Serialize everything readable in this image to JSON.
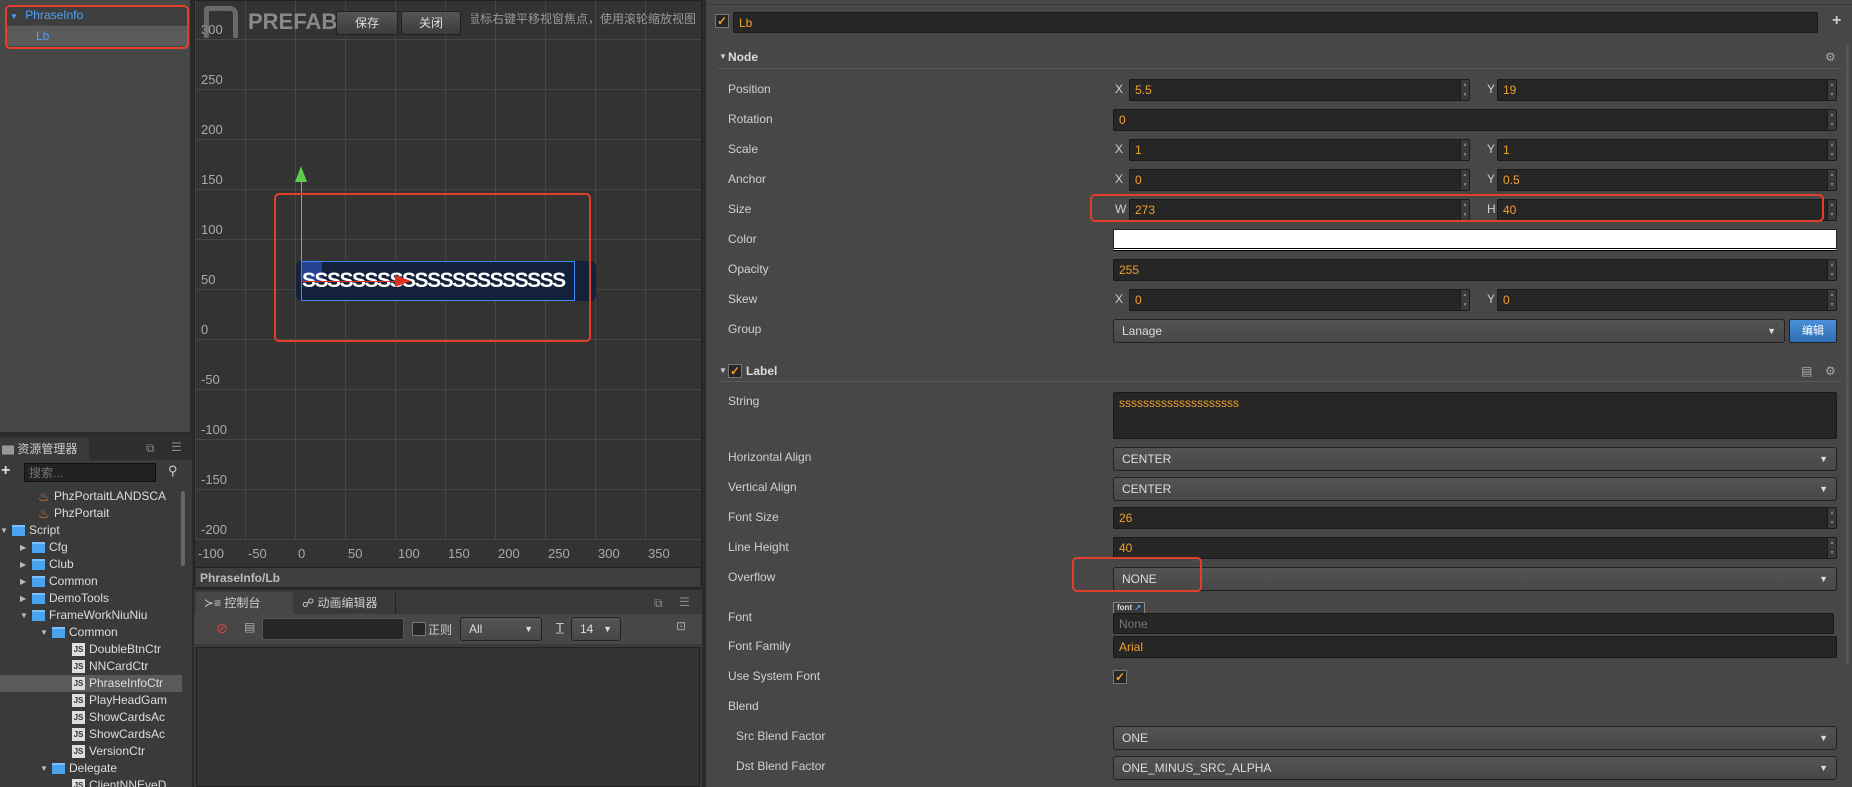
{
  "hierarchy": {
    "items": [
      {
        "label": "PhraseInfo",
        "expanded": true
      },
      {
        "label": "Lb",
        "selected": true
      }
    ]
  },
  "scene": {
    "logo": "PREFAB",
    "save_label": "保存",
    "close_label": "关闭",
    "hint": "按下鼠标右键平移视窗焦点，使用滚轮缩放视图",
    "y_ticks": [
      "300",
      "250",
      "200",
      "150",
      "100",
      "50",
      "0",
      "-50",
      "-100",
      "-150",
      "-200"
    ],
    "x_ticks": [
      "-100",
      "-50",
      "0",
      "50",
      "100",
      "150",
      "200",
      "250",
      "300",
      "350"
    ],
    "node_text": "SSSSSSSSSSSSSSSSSSSSS",
    "path": "PhraseInfo/Lb"
  },
  "assets": {
    "tab": "资源管理器",
    "search_placeholder": "搜索...",
    "items": [
      {
        "label": "PhzPortaitLANDSCA",
        "icon": "fire",
        "depth": 2
      },
      {
        "label": "PhzPortait",
        "icon": "fire",
        "depth": 2
      },
      {
        "label": "Script",
        "icon": "folder",
        "depth": 1,
        "arrow": "down"
      },
      {
        "label": "Cfg",
        "icon": "folder",
        "depth": 2,
        "arrow": "right"
      },
      {
        "label": "Club",
        "icon": "folder",
        "depth": 2,
        "arrow": "right"
      },
      {
        "label": "Common",
        "icon": "folder",
        "depth": 2,
        "arrow": "right"
      },
      {
        "label": "DemoTools",
        "icon": "folder",
        "depth": 2,
        "arrow": "right"
      },
      {
        "label": "FrameWorkNiuNiu",
        "icon": "folder",
        "depth": 2,
        "arrow": "down"
      },
      {
        "label": "Common",
        "icon": "folder",
        "depth": 3,
        "arrow": "down"
      },
      {
        "label": "DoubleBtnCtr",
        "icon": "js",
        "depth": 4
      },
      {
        "label": "NNCardCtr",
        "icon": "js",
        "depth": 4
      },
      {
        "label": "PhraseInfoCtr",
        "icon": "js",
        "depth": 4,
        "selected": true
      },
      {
        "label": "PlayHeadGam",
        "icon": "js",
        "depth": 4
      },
      {
        "label": "ShowCardsAc",
        "icon": "js",
        "depth": 4
      },
      {
        "label": "ShowCardsAc",
        "icon": "js",
        "depth": 4
      },
      {
        "label": "VersionCtr",
        "icon": "js",
        "depth": 4
      },
      {
        "label": "Delegate",
        "icon": "folder",
        "depth": 3,
        "arrow": "down"
      },
      {
        "label": "ClientNNEveD",
        "icon": "js",
        "depth": 4
      }
    ]
  },
  "console": {
    "tab_console": "控制台",
    "tab_anim": "动画编辑器",
    "regex_label": "正则",
    "level": "All",
    "font_size": "14"
  },
  "inspector": {
    "node_name": "Lb",
    "node_header": "Node",
    "label_header": "Label",
    "accent": "#f0a030",
    "rows": [
      {
        "label": "Position",
        "type": "vec2",
        "a": "X",
        "av": "5.5",
        "b": "Y",
        "bv": "19"
      },
      {
        "label": "Rotation",
        "type": "num",
        "v": "0"
      },
      {
        "label": "Scale",
        "type": "vec2",
        "a": "X",
        "av": "1",
        "b": "Y",
        "bv": "1"
      },
      {
        "label": "Anchor",
        "type": "vec2",
        "a": "X",
        "av": "0",
        "b": "Y",
        "bv": "0.5"
      },
      {
        "label": "Size",
        "type": "vec2",
        "a": "W",
        "av": "273",
        "b": "H",
        "bv": "40"
      },
      {
        "label": "Color",
        "type": "color",
        "v": "#ffffff"
      },
      {
        "label": "Opacity",
        "type": "num",
        "v": "255"
      },
      {
        "label": "Skew",
        "type": "vec2",
        "a": "X",
        "av": "0",
        "b": "Y",
        "bv": "0"
      },
      {
        "label": "Group",
        "type": "selbtn",
        "v": "Lanage",
        "btn": "编辑"
      }
    ],
    "label_rows": [
      {
        "label": "String",
        "type": "textarea",
        "v": "ssssssssssssssssssss"
      },
      {
        "label": "Horizontal Align",
        "type": "select",
        "v": "CENTER"
      },
      {
        "label": "Vertical Align",
        "type": "select",
        "v": "CENTER"
      },
      {
        "label": "Font Size",
        "type": "num",
        "v": "26"
      },
      {
        "label": "Line Height",
        "type": "num",
        "v": "40"
      },
      {
        "label": "Overflow",
        "type": "select",
        "v": "NONE"
      },
      {
        "label": "Font",
        "type": "asset",
        "tag": "font",
        "v": "None"
      },
      {
        "label": "Font Family",
        "type": "text",
        "v": "Arial"
      },
      {
        "label": "Use System Font",
        "type": "check",
        "v": true
      },
      {
        "label": "Blend",
        "type": "heading"
      },
      {
        "label": "Src Blend Factor",
        "type": "select",
        "v": "ONE",
        "indent": true
      },
      {
        "label": "Dst Blend Factor",
        "type": "select",
        "v": "ONE_MINUS_SRC_ALPHA",
        "indent": true
      }
    ]
  }
}
